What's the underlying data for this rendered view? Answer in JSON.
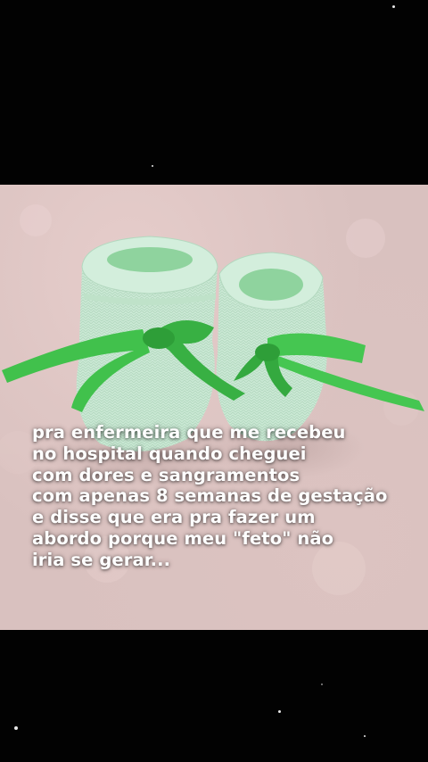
{
  "caption": {
    "lines": [
      "pra enfermeira que me recebeu",
      "no hospital quando cheguei",
      "com dores e sangramentos",
      "com apenas 8 semanas de gestação",
      "e disse que era pra fazer um",
      "abordo porque meu \"feto\" não",
      "iria se gerar..."
    ]
  },
  "colors": {
    "background": "#020202",
    "blanket": "#d9c1bf",
    "bootie": "#c9e8d3",
    "ribbon": "#3fbf4a",
    "text": "#ffffff"
  }
}
